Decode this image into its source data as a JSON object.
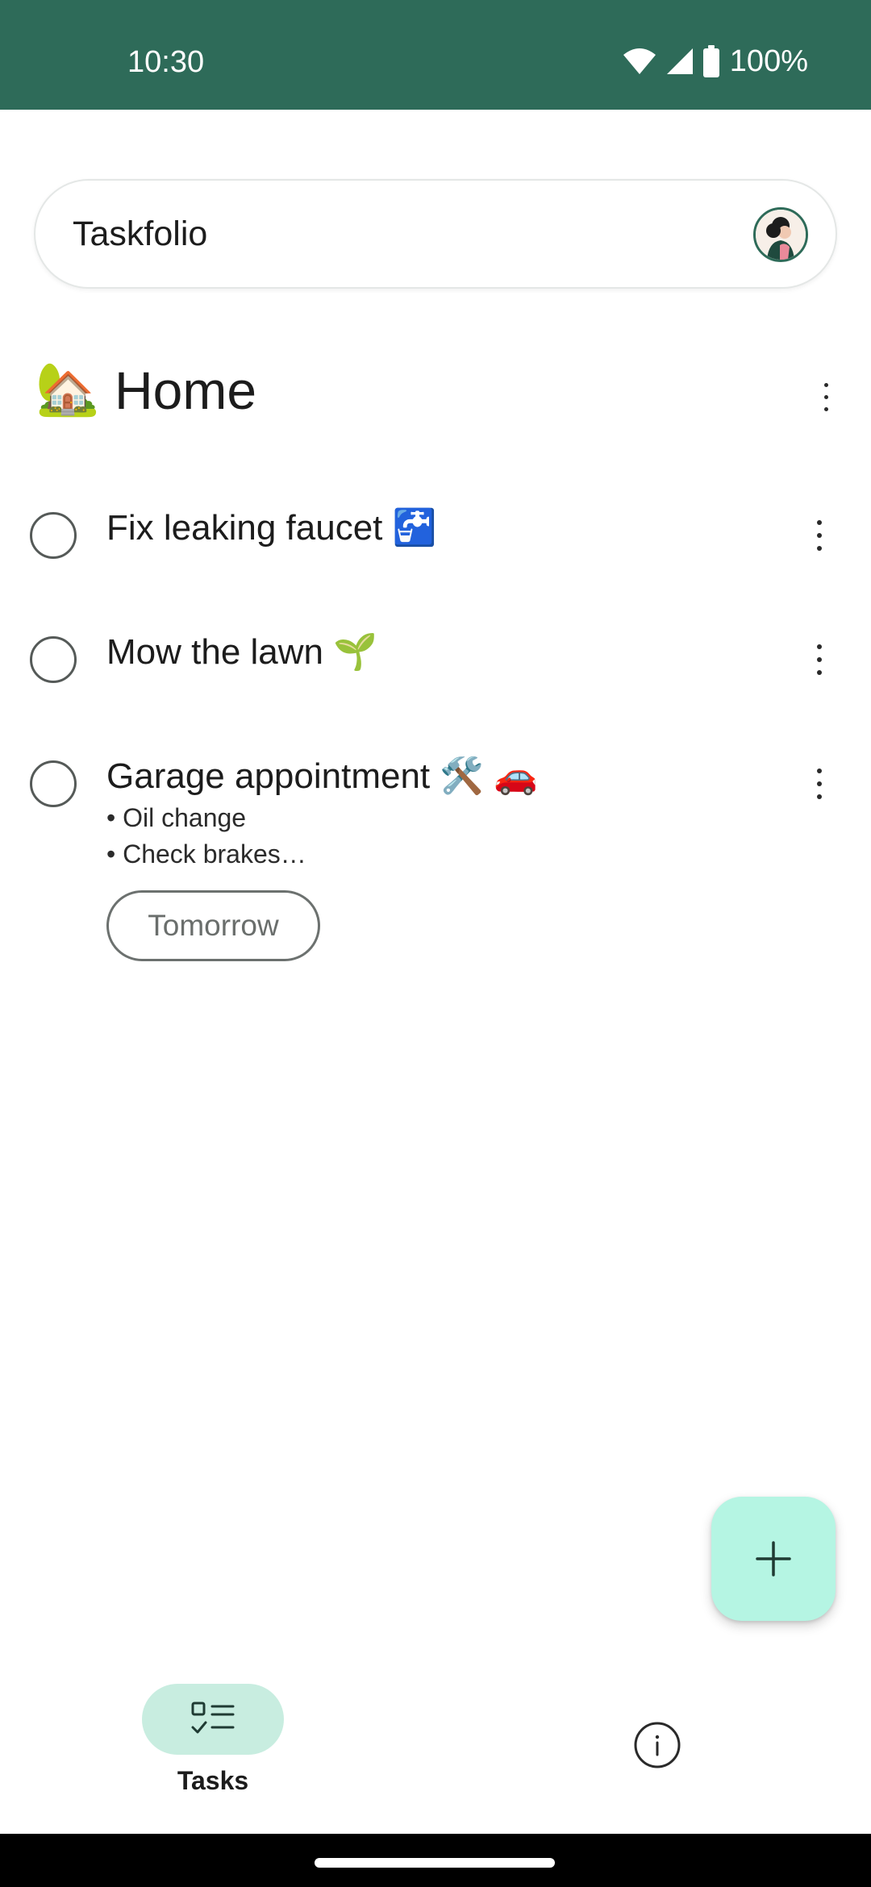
{
  "status_bar": {
    "time": "10:30",
    "battery": "100%",
    "icons": [
      "wifi-icon",
      "cell-signal-icon",
      "battery-icon"
    ]
  },
  "search": {
    "app_title": "Taskfolio"
  },
  "list": {
    "emoji": "🏡",
    "title": "Home"
  },
  "tasks": [
    {
      "title": "Fix leaking faucet 🚰"
    },
    {
      "title": "Mow the lawn 🌱"
    },
    {
      "title": "Garage appointment 🛠️ 🚗",
      "notes": [
        "• Oil change",
        "• Check brakes…"
      ],
      "due_chip": "Tomorrow"
    }
  ],
  "bottom_nav": {
    "tasks_label": "Tasks",
    "items": [
      "checklist-icon",
      "info-icon"
    ]
  },
  "colors": {
    "status_bar": "#2e6b59",
    "fab": "#b5f5e3",
    "nav_active_pill": "#c8ede0"
  }
}
